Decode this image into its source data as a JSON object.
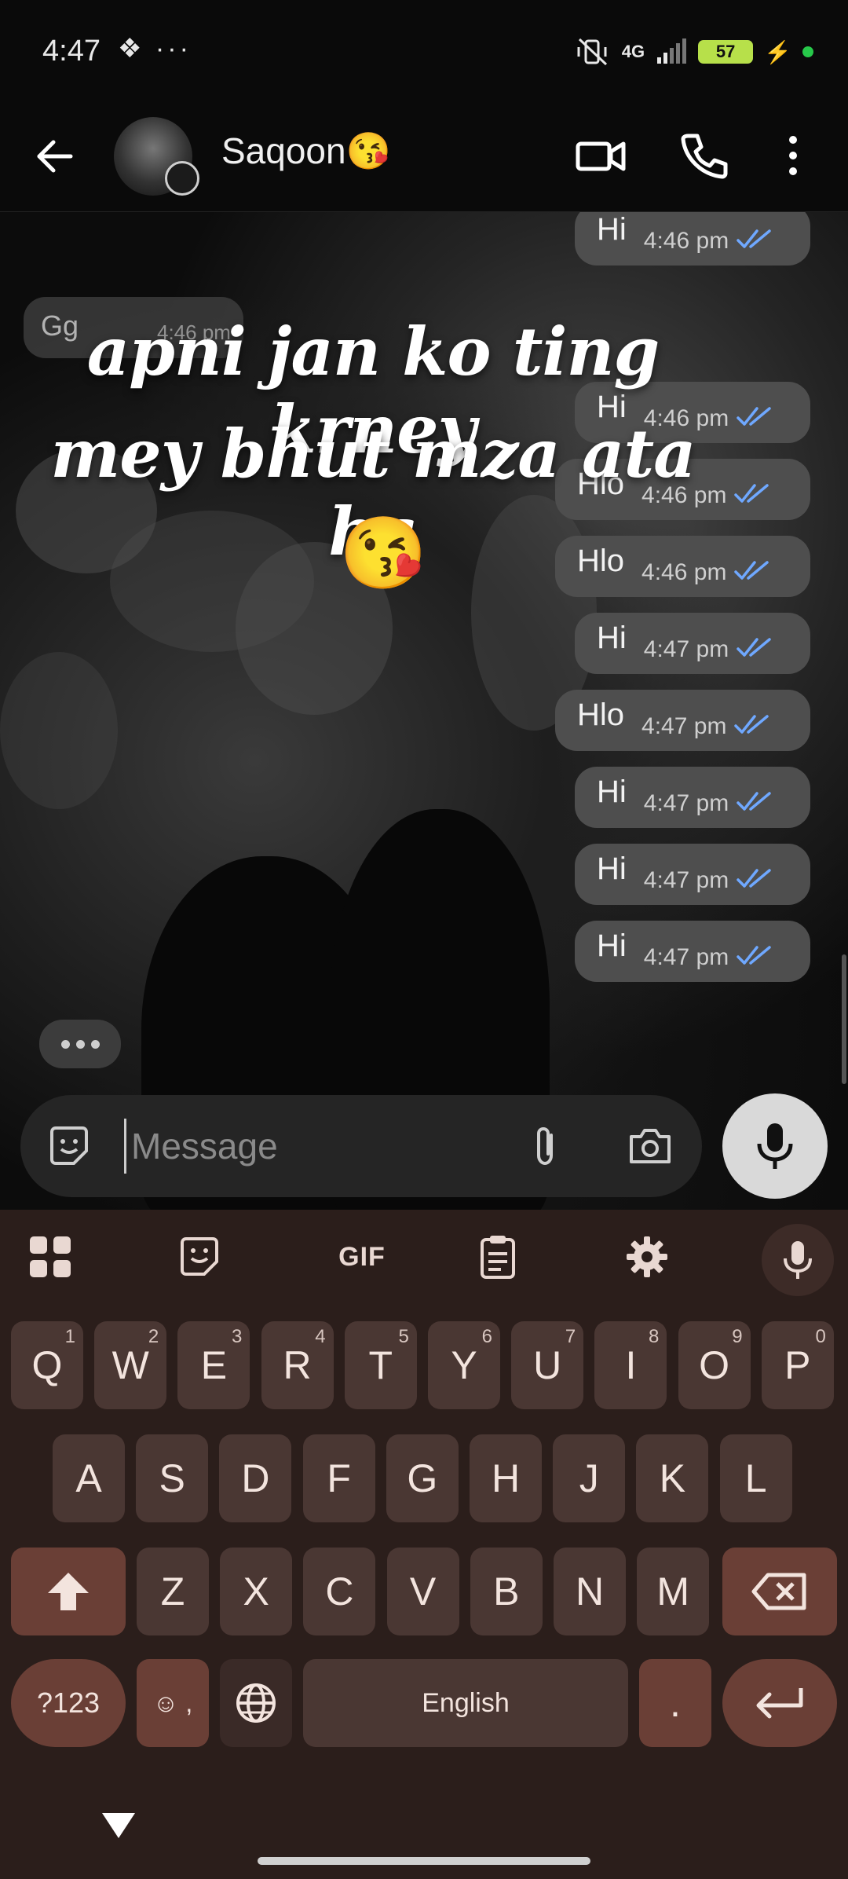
{
  "status_bar": {
    "time": "4:47",
    "extras": "❖ ···",
    "network": "4G",
    "battery": "57"
  },
  "header": {
    "contact_name": "Saqoon😘"
  },
  "chat": {
    "incoming": {
      "text": "Gg",
      "time": "4:46 pm"
    },
    "overlay_lines": [
      "apni jan ko ting krney",
      "mey bhut mza ata ha"
    ],
    "overlay_emoji": "😘",
    "messages": [
      {
        "text": "Hi",
        "time": "4:46 pm"
      },
      {
        "text": "Hi",
        "time": "4:46 pm"
      },
      {
        "text": "Hlo",
        "time": "4:46 pm"
      },
      {
        "text": "Hlo",
        "time": "4:46 pm"
      },
      {
        "text": "Hi",
        "time": "4:47 pm"
      },
      {
        "text": "Hlo",
        "time": "4:47 pm"
      },
      {
        "text": "Hi",
        "time": "4:47 pm"
      },
      {
        "text": "Hi",
        "time": "4:47 pm"
      },
      {
        "text": "Hi",
        "time": "4:47 pm"
      }
    ],
    "tick_color": "#6fa8ff"
  },
  "composer": {
    "placeholder": "Message",
    "value": ""
  },
  "keyboard": {
    "toolbar_gif": "GIF",
    "row1": [
      {
        "label": "Q",
        "hint": "1"
      },
      {
        "label": "W",
        "hint": "2"
      },
      {
        "label": "E",
        "hint": "3"
      },
      {
        "label": "R",
        "hint": "4"
      },
      {
        "label": "T",
        "hint": "5"
      },
      {
        "label": "Y",
        "hint": "6"
      },
      {
        "label": "U",
        "hint": "7"
      },
      {
        "label": "I",
        "hint": "8"
      },
      {
        "label": "O",
        "hint": "9"
      },
      {
        "label": "P",
        "hint": "0"
      }
    ],
    "row2": [
      "A",
      "S",
      "D",
      "F",
      "G",
      "H",
      "J",
      "K",
      "L"
    ],
    "row3": [
      "Z",
      "X",
      "C",
      "V",
      "B",
      "N",
      "M"
    ],
    "symbols_label": "?123",
    "emoji_comma": "☺ ,",
    "space_label": "English",
    "period_label": "."
  }
}
